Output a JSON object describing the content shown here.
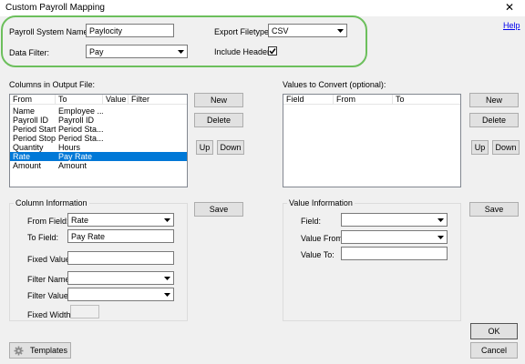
{
  "window": {
    "title": "Custom Payroll Mapping",
    "close_glyph": "✕",
    "help_label": "Help"
  },
  "top": {
    "payroll_system_name_label": "Payroll System Name:",
    "payroll_system_name_value": "Paylocity",
    "data_filter_label": "Data Filter:",
    "data_filter_value": "Pay",
    "export_filetype_label": "Export Filetype:",
    "export_filetype_value": "CSV",
    "include_header_label": "Include Header",
    "include_header_checked": true
  },
  "columns": {
    "label": "Columns in Output File:",
    "headers": [
      "From",
      "To",
      "Value",
      "Filter"
    ],
    "rows": [
      {
        "from": "Name",
        "to": "Employee ..."
      },
      {
        "from": "Payroll ID",
        "to": "Payroll ID"
      },
      {
        "from": "Period Start",
        "to": "Period Sta..."
      },
      {
        "from": "Period Stop",
        "to": "Period Sta..."
      },
      {
        "from": "Quantity",
        "to": "Hours"
      },
      {
        "from": "Rate",
        "to": "Pay Rate"
      },
      {
        "from": "Amount",
        "to": "Amount"
      }
    ],
    "selected_row": "Rate",
    "new_label": "New",
    "delete_label": "Delete",
    "up_label": "Up",
    "down_label": "Down"
  },
  "values": {
    "label": "Values to Convert (optional):",
    "headers": [
      "Field",
      "From",
      "To"
    ],
    "new_label": "New",
    "delete_label": "Delete",
    "up_label": "Up",
    "down_label": "Down"
  },
  "column_info": {
    "title": "Column Information",
    "from_field_label": "From Field:",
    "from_field_value": "Rate",
    "to_field_label": "To Field:",
    "to_field_value": "Pay Rate",
    "fixed_value_label": "Fixed Value:",
    "fixed_value_value": "",
    "filter_name_label": "Filter Name:",
    "filter_name_value": "",
    "filter_value_label": "Filter Value:",
    "filter_value_value": "",
    "fixed_width_label": "Fixed Width:",
    "save_label": "Save"
  },
  "value_info": {
    "title": "Value Information",
    "field_label": "Field:",
    "value_from_label": "Value From:",
    "value_to_label": "Value To:",
    "save_label": "Save"
  },
  "footer": {
    "templates_label": "Templates",
    "templates_icon": "gear-icon",
    "ok_label": "OK",
    "cancel_label": "Cancel"
  },
  "colors": {
    "selection": "#0078d7",
    "highlight_outline": "#6cbf5c",
    "link": "#0000ee"
  }
}
